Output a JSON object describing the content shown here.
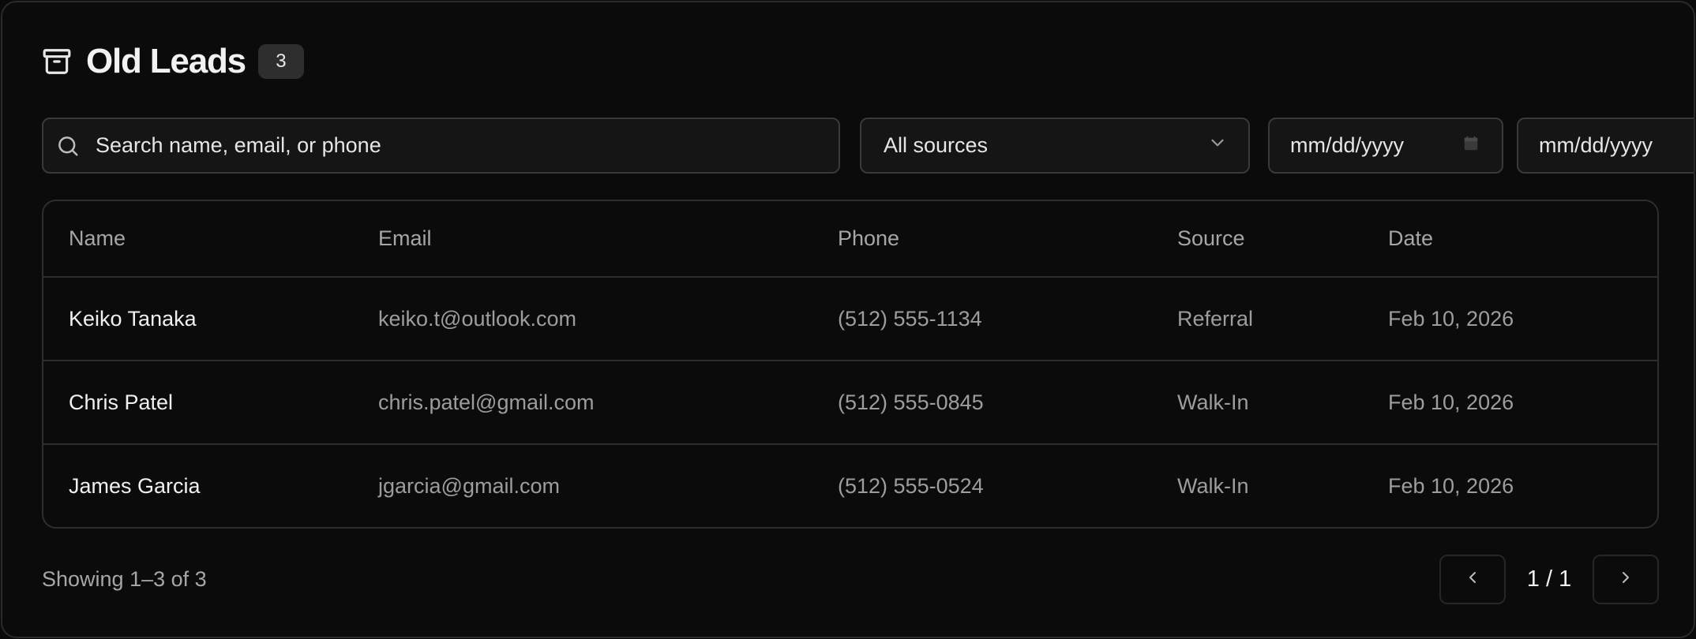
{
  "header": {
    "icon": "archive-icon",
    "title": "Old Leads",
    "count": "3"
  },
  "filters": {
    "search_placeholder": "Search name, email, or phone",
    "source_value": "All sources",
    "date_from_placeholder": "mm/dd/yyyy",
    "date_to_placeholder": "mm/dd/yyyy"
  },
  "table": {
    "columns": [
      "Name",
      "Email",
      "Phone",
      "Source",
      "Date"
    ],
    "rows": [
      {
        "name": "Keiko Tanaka",
        "email": "keiko.t@outlook.com",
        "phone": "(512) 555-1134",
        "source": "Referral",
        "date": "Feb 10, 2026"
      },
      {
        "name": "Chris Patel",
        "email": "chris.patel@gmail.com",
        "phone": "(512) 555-0845",
        "source": "Walk-In",
        "date": "Feb 10, 2026"
      },
      {
        "name": "James Garcia",
        "email": "jgarcia@gmail.com",
        "phone": "(512) 555-0524",
        "source": "Walk-In",
        "date": "Feb 10, 2026"
      }
    ]
  },
  "footer": {
    "showing_text": "Showing 1–3 of 3",
    "page_indicator": "1 / 1"
  },
  "colors": {
    "background": "#0b0b0b",
    "border": "#2e2e2e",
    "text_primary": "#ededed",
    "text_muted": "#9d9d9d",
    "badge_bg": "#2e2e2e"
  }
}
